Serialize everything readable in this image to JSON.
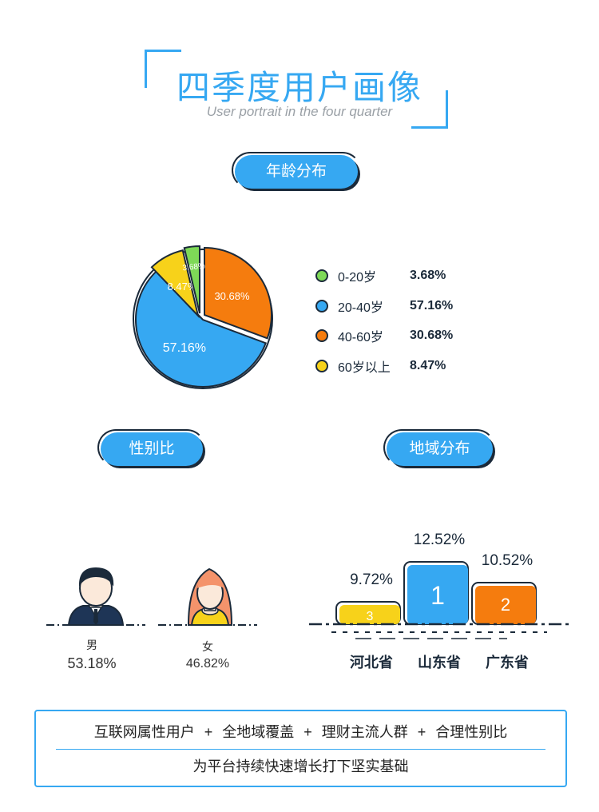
{
  "header": {
    "title": "四季度用户画像",
    "subtitle": "User portrait in the four quarter"
  },
  "sections": {
    "age": "年龄分布",
    "gender": "性别比",
    "region": "地域分布"
  },
  "colors": {
    "blue": "#36a8f2",
    "orange": "#f57c0e",
    "yellow": "#f7d21a",
    "green": "#7ed957",
    "dark": "#1b2a3a"
  },
  "chart_data": [
    {
      "type": "pie",
      "categories": [
        "0-20岁",
        "20-40岁",
        "40-60岁",
        "60岁以上"
      ],
      "values": [
        3.68,
        57.16,
        30.68,
        8.47
      ],
      "labels": [
        "3.68%",
        "57.16%",
        "30.68%",
        "8.47%"
      ],
      "colors": [
        "#7ed957",
        "#36a8f2",
        "#f57c0e",
        "#f7d21a"
      ],
      "legend_position": "right"
    },
    {
      "type": "bar",
      "categories": [
        "河北省",
        "山东省",
        "广东省"
      ],
      "values": [
        9.72,
        12.52,
        10.52
      ],
      "labels": [
        "9.72%",
        "12.52%",
        "10.52%"
      ],
      "ranks": [
        "3",
        "1",
        "2"
      ],
      "colors": [
        "#f7d21a",
        "#36a8f2",
        "#f57c0e"
      ]
    }
  ],
  "gender": {
    "male": {
      "label": "男",
      "value": "53.18%"
    },
    "female": {
      "label": "女",
      "value": "46.82%"
    }
  },
  "footer": {
    "items": [
      "互联网属性用户",
      "+",
      "全地域覆盖",
      "+",
      "理财主流人群",
      "+",
      "合理性别比"
    ],
    "tagline": "为平台持续快速增长打下坚实基础"
  }
}
